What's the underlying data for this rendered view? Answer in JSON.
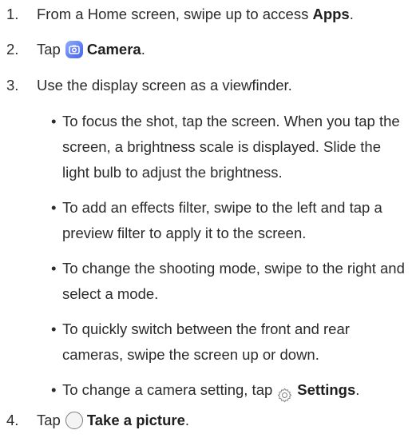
{
  "steps": [
    {
      "number": "1.",
      "pre": "From a Home screen, swipe up to access ",
      "bold": "Apps",
      "post": "."
    },
    {
      "number": "2.",
      "pre": "Tap",
      "icon": "camera-icon",
      "bold": "Camera",
      "post": "."
    },
    {
      "number": "3.",
      "text": "Use the display screen as a viewfinder."
    },
    {
      "number": "4.",
      "pre": "Tap",
      "icon": "shutter-icon",
      "bold": "Take a picture",
      "post": "."
    }
  ],
  "bullet_symbol": "•",
  "bullets": [
    {
      "text": "To focus the shot, tap the screen. When you tap the screen, a brightness scale is displayed. Slide the light bulb to adjust the brightness."
    },
    {
      "text": "To add an effects filter, swipe to the left and tap a preview filter to apply it to the screen."
    },
    {
      "text": "To change the shooting mode, swipe to the right and select a mode."
    },
    {
      "text": "To quickly switch between the front and rear cameras, swipe the screen up or down."
    },
    {
      "pre": "To change a camera setting, tap",
      "icon": "gear-icon",
      "bold": "Settings",
      "post": "."
    }
  ],
  "colors": {
    "text": "#2b2b2b",
    "camera_icon": "#5f7cf2",
    "icon_gray": "#7d7d7d"
  }
}
